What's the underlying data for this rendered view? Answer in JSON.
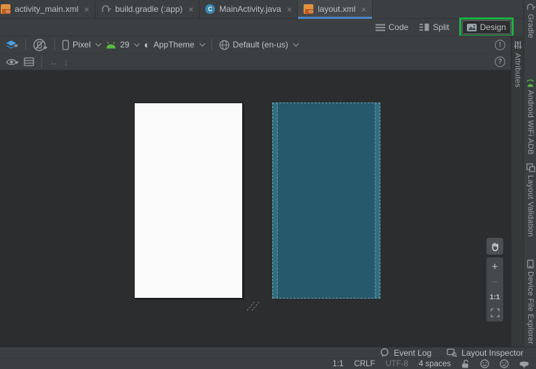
{
  "tabs": [
    {
      "label": "activity_main.xml",
      "close": "×"
    },
    {
      "label": "build.gradle (:app)",
      "close": "×"
    },
    {
      "label": "MainActivity.java",
      "close": "×",
      "class_letter": "C"
    },
    {
      "label": "layout.xml",
      "close": "×"
    }
  ],
  "mode_switcher": {
    "code_label": "Code",
    "split_label": "Split",
    "design_label": "Design"
  },
  "design_toolbar": {
    "device_selector": "Pixel",
    "api_level": "29",
    "theme_selector": "AppTheme",
    "locale_selector": "Default (en-us)",
    "warning_glyph": "!",
    "help_glyph": "?",
    "theme_icon_glyph": "◐",
    "width_arrow": "↔",
    "height_arrow": "↕"
  },
  "zoom_controls": {
    "zoom_in_label": "+",
    "zoom_out_label": "−",
    "zoom_ratio_label": "1:1"
  },
  "right_tool_tabs": {
    "attributes": "Attributes",
    "gradle": "Gradle",
    "android_wifi_adb": "Android WiFi ADB",
    "layout_validation": "Layout Validation",
    "device_file_explorer": "Device File Explorer"
  },
  "bottom_bar": {
    "event_log_label": "Event Log",
    "layout_inspector_label": "Layout Inspector"
  },
  "status_bar": {
    "caret_position": "1:1",
    "line_separator": "CRLF",
    "encoding": "UTF-8",
    "indent": "4 spaces"
  },
  "colors": {
    "accent_blue": "#4a88c7",
    "annotation_green": "#1eae44",
    "android_green": "#57ba47",
    "layers_blue": "#4a9fe3",
    "blueprint_fill": "#26596a",
    "blueprint_margin_band": "#336e7e",
    "blueprint_border": "#6fa9b8",
    "device_preview_white": "#fbfbfb",
    "ide_background": "#3c3f41",
    "canvas_background": "#2b2d2e"
  }
}
